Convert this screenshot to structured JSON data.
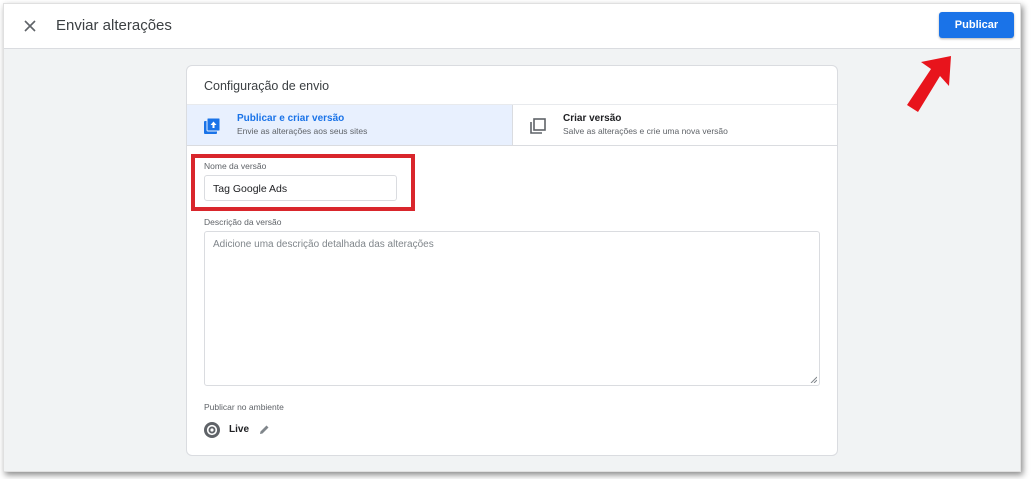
{
  "header": {
    "title": "Enviar alterações",
    "publish_label": "Publicar"
  },
  "card": {
    "title": "Configuração de envio",
    "options": [
      {
        "label": "Publicar e criar versão",
        "sub": "Envie as alterações aos seus sites",
        "icon": "publish-upload-icon",
        "selected": true
      },
      {
        "label": "Criar versão",
        "sub": "Salve as alterações e crie uma nova versão",
        "icon": "copy-version-icon",
        "selected": false
      }
    ],
    "version_name": {
      "label": "Nome da versão",
      "value": "Tag Google Ads"
    },
    "version_description": {
      "label": "Descrição da versão",
      "placeholder": "Adicione uma descrição detalhada das alterações"
    },
    "environment": {
      "label": "Publicar no ambiente",
      "name": "Live",
      "icon": "environment-icon"
    }
  },
  "colors": {
    "accent": "#1a73e8",
    "selected_bg": "#e8f0fe",
    "highlight": "#d9262c"
  }
}
